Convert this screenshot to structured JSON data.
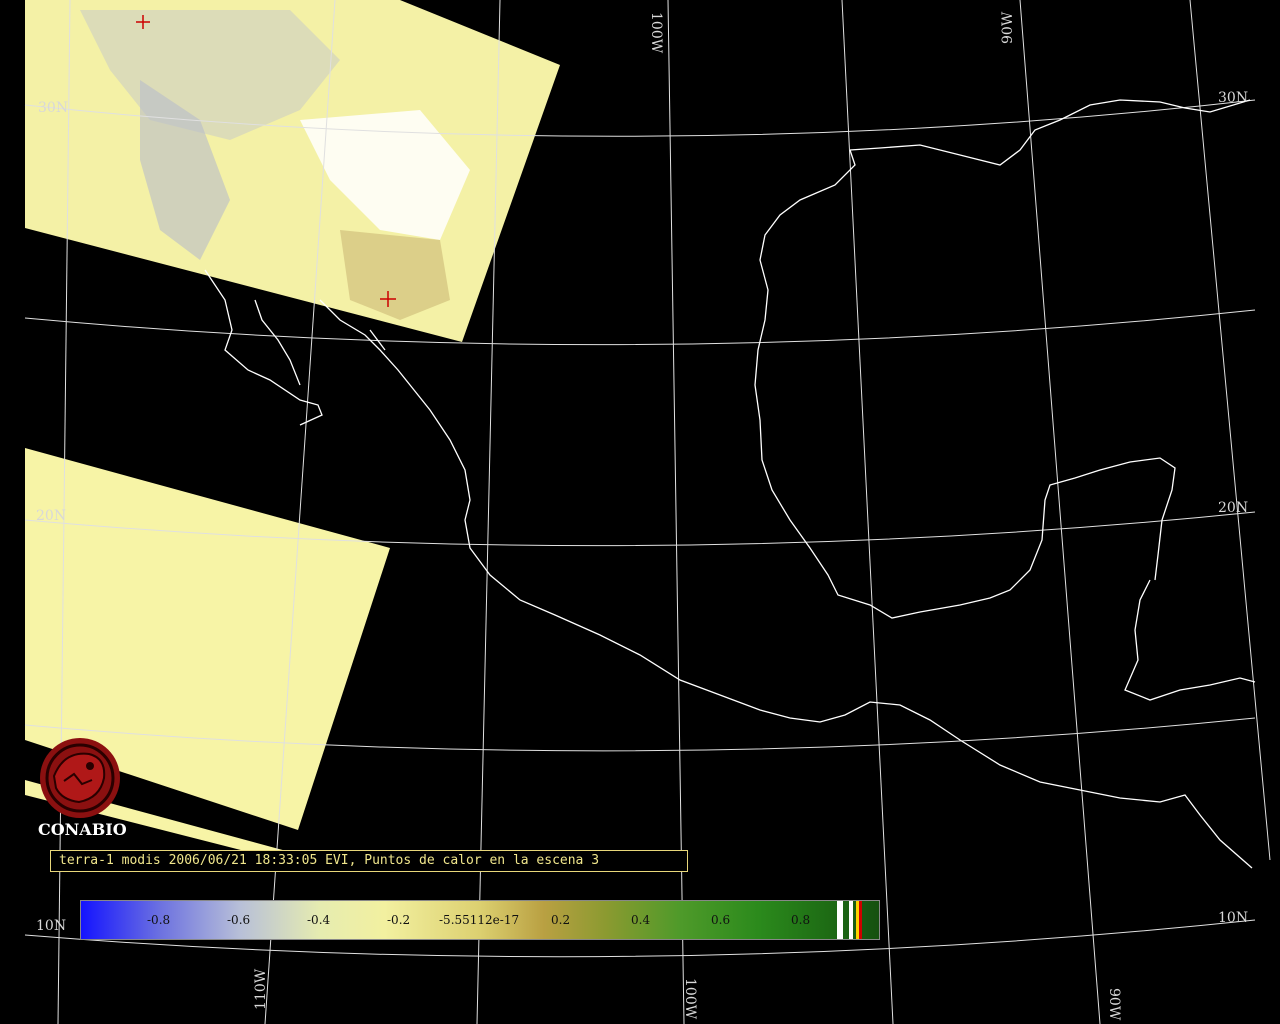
{
  "caption": "terra-1 modis 2006/06/21 18:33:05 EVI, Puntos de calor en la escena 3",
  "logo_text": "CONABIO",
  "grid_labels": {
    "lat_30n_left": "30N",
    "lat_30n_right": "30N",
    "lat_20n_left": "20N",
    "lat_20n_right": "20N",
    "lat_10n_left": "10N",
    "lat_10n_right": "10N",
    "lon_100w_top": "100W",
    "lon_90w_top": "90W",
    "lon_110w_bottom": "110W",
    "lon_100w_bottom": "100W",
    "lon_90w_bottom": "90W"
  },
  "legend": {
    "ticks": [
      "-0.8",
      "-0.6",
      "-0.4",
      "-0.2",
      "-5.55112e-17",
      "0.2",
      "0.4",
      "0.6",
      "0.8"
    ],
    "colors": [
      "#1414ff",
      "#b8c0d8",
      "#f2f0a0",
      "#b9a042",
      "#2b8a1c",
      "#155010"
    ]
  },
  "colors": {
    "grid": "#e0e0e0",
    "coastline": "#ffffff",
    "scene_fill": "#f5f2a2",
    "hotspot_marker": "#cc0000",
    "caption": "#f0e68c"
  }
}
